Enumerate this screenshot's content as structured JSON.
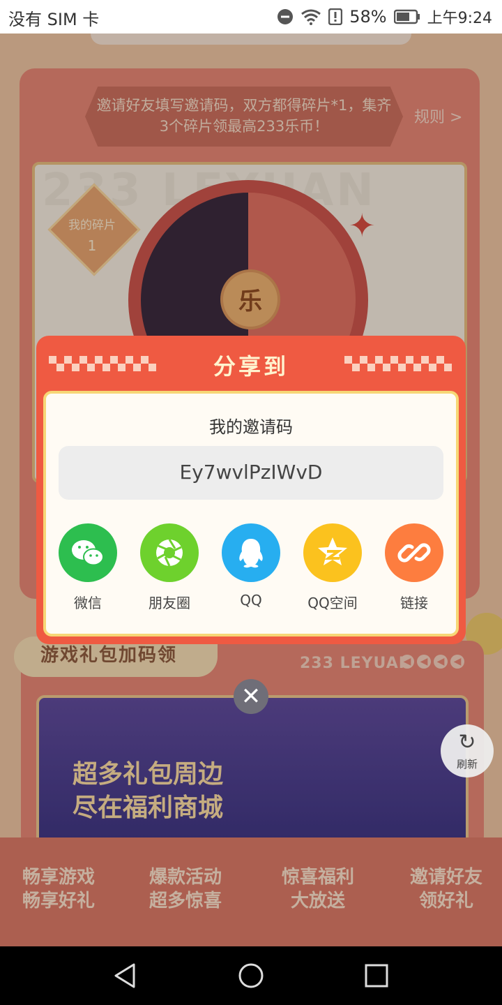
{
  "status_bar": {
    "carrier": "没有 SIM 卡",
    "battery": "58%",
    "time": "上午9:24"
  },
  "invite": {
    "banner_text": "邀请好友填写邀请码，双方都得碎片*1，集齐3个碎片领最高233乐币！",
    "rule_link": "规则 >",
    "watermark": "233 LEYUAN",
    "fragment_label": "我的碎片",
    "fragment_count": "1",
    "wheel_center": "乐"
  },
  "gift_section": {
    "title": "游戏礼包加码领",
    "leyuan": "233 LEYUAN",
    "banner_text_1": "超多礼包周边",
    "banner_text_2": "尽在福利商城",
    "features": [
      {
        "line1": "畅享游戏",
        "line2": "畅享好礼"
      },
      {
        "line1": "爆款活动",
        "line2": "超多惊喜"
      },
      {
        "line1": "惊喜福利",
        "line2": "大放送"
      },
      {
        "line1": "邀请好友",
        "line2": "领好礼"
      }
    ]
  },
  "refresh": {
    "label": "刷新"
  },
  "modal": {
    "title": "分享到",
    "subtitle": "我的邀请码",
    "code": "Ey7wvlPzIWvD",
    "share_options": [
      {
        "label": "微信",
        "icon": "wechat-icon",
        "color": "#2dbe4f"
      },
      {
        "label": "朋友圈",
        "icon": "moments-icon",
        "color": "#6ed12d"
      },
      {
        "label": "QQ",
        "icon": "qq-icon",
        "color": "#27aef0"
      },
      {
        "label": "QQ空间",
        "icon": "qzone-icon",
        "color": "#fbc21e"
      },
      {
        "label": "链接",
        "icon": "link-icon",
        "color": "#fd7d3f"
      }
    ],
    "close_glyph": "✕"
  }
}
